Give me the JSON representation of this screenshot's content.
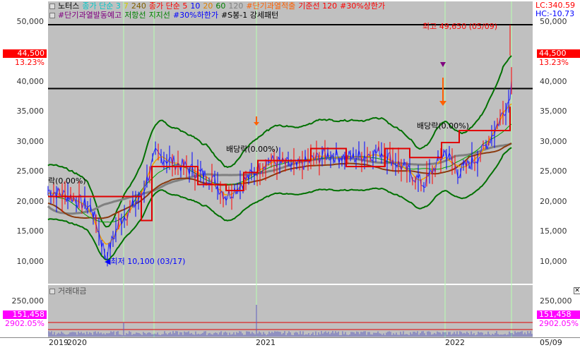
{
  "legend_row1": [
    {
      "label": "노터스",
      "color": "#000000"
    },
    {
      "label": "종가 단순 3",
      "color": "#00c8c8"
    },
    {
      "label": "7",
      "color": "#d0d000"
    },
    {
      "label": "240",
      "color": "#806000"
    },
    {
      "label": "종가 단순 5",
      "color": "#ff0000"
    },
    {
      "label": "10",
      "color": "#0000ff"
    },
    {
      "label": "20",
      "color": "#e08000"
    },
    {
      "label": "60",
      "color": "#008000"
    },
    {
      "label": "120",
      "color": "#808080"
    },
    {
      "label": "#단기과열적출",
      "color": "#ff6000"
    },
    {
      "label": "기준선 120",
      "color": "#ff0000"
    },
    {
      "label": "#30%상한가",
      "color": "#ff0000"
    }
  ],
  "legend_row2": [
    {
      "label": "#단기과열발동예고",
      "color": "#800080"
    },
    {
      "label": "저항선",
      "color": "#008000"
    },
    {
      "label": "지지선",
      "color": "#008000"
    },
    {
      "label": "#30%하한가",
      "color": "#0000ff"
    },
    {
      "label": "#S봉-1 강세패턴",
      "color": "#000000"
    }
  ],
  "lc_label": "LC:340.59",
  "hc_label": "HC:-10.73",
  "price_ticks": [
    "50,000",
    "45,000",
    "40,000",
    "35,000",
    "30,000",
    "25,000",
    "20,000",
    "15,000",
    "10,000"
  ],
  "current_price": "44,500",
  "current_pct": "13.23%",
  "volume_ticks": [
    "250,000"
  ],
  "volume_label": "거래대금",
  "current_volume": "151,458",
  "volume_pct": "2902.05%",
  "x_labels": [
    "2019",
    "2020",
    "2021",
    "2022",
    "05/09"
  ],
  "annotations": {
    "high": "최고 49,650 (05/09)",
    "low": "최저 10,100 (03/17)",
    "dividend1": "배당락(0.00%)",
    "dividend2": "배당락(0.00%)",
    "dividend0": "락(0.00%)"
  },
  "colors": {
    "plot_bg": "#c0c0c0",
    "price_tag_bg": "#ff0000",
    "volume_tag_bg": "#ff00ff",
    "band": "#008000",
    "support": "#e00000"
  }
}
